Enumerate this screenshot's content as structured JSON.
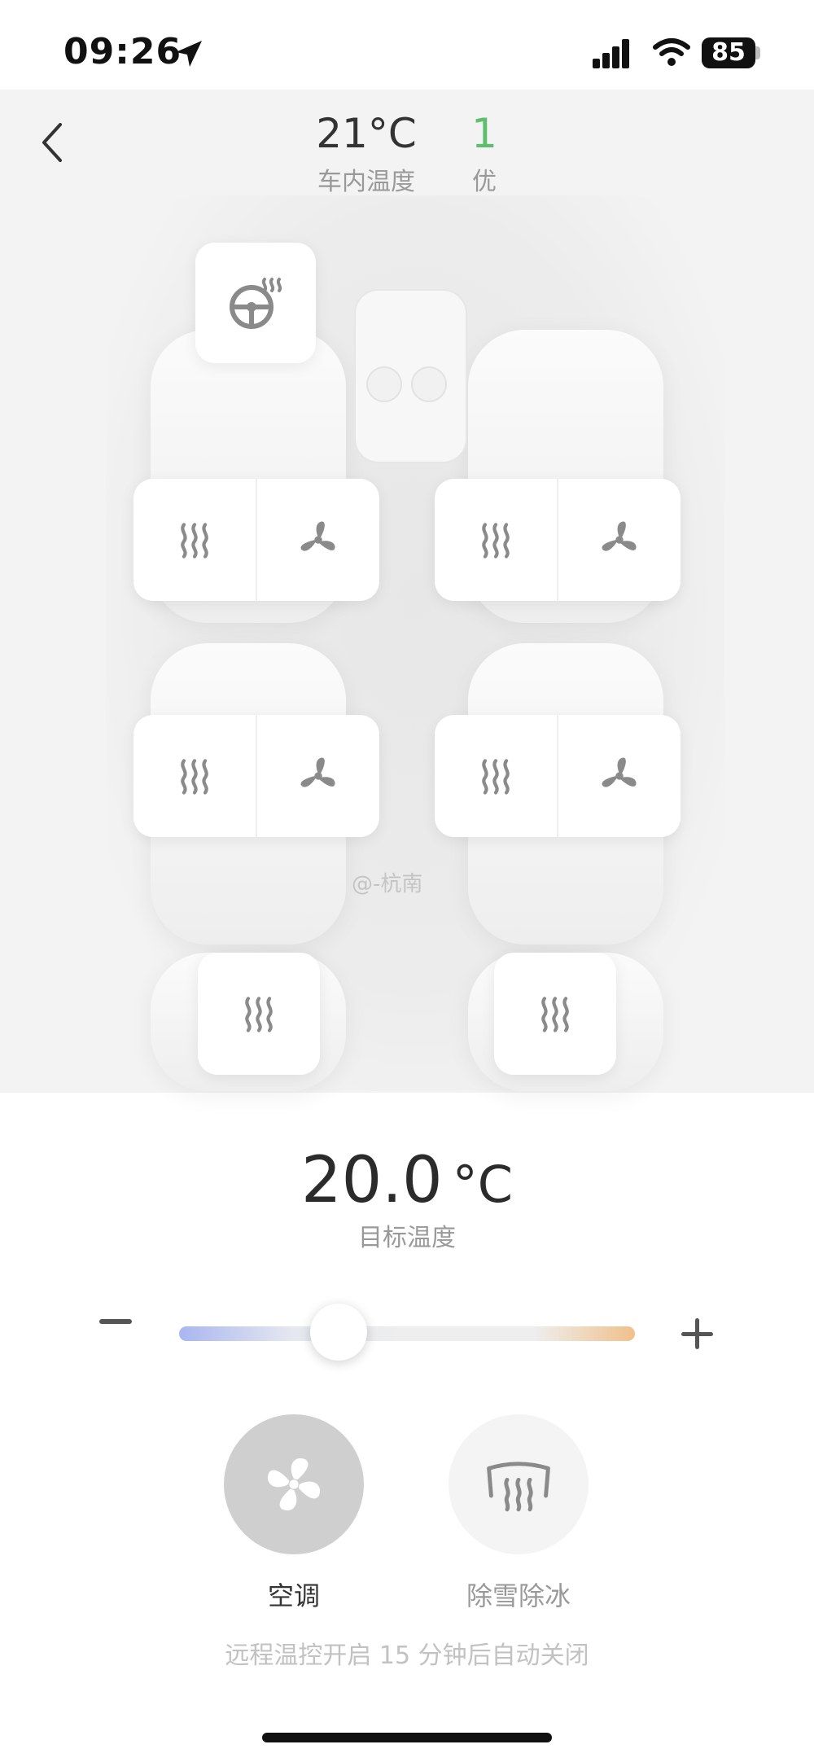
{
  "status_bar": {
    "time": "09:26",
    "battery": "85"
  },
  "header": {
    "cabin_temperature": "21°C",
    "cabin_temperature_label": "车内温度",
    "air_quality_value": "1",
    "air_quality_label": "优",
    "air_quality_color": "#5bbf6c"
  },
  "watermark": "@-杭南",
  "climate": {
    "target_temperature": "20.0",
    "unit": "°C",
    "target_label": "目标温度",
    "slider_level": 0.35
  },
  "buttons": {
    "ac_label": "空调",
    "defrost_label": "除雪除冰"
  },
  "note": "远程温控开启 15 分钟后自动关闭",
  "colors": {
    "accent_cool": "#a9b6f0",
    "accent_warm": "#f1c08a",
    "ac_active_bg": "#cfcfcf"
  }
}
